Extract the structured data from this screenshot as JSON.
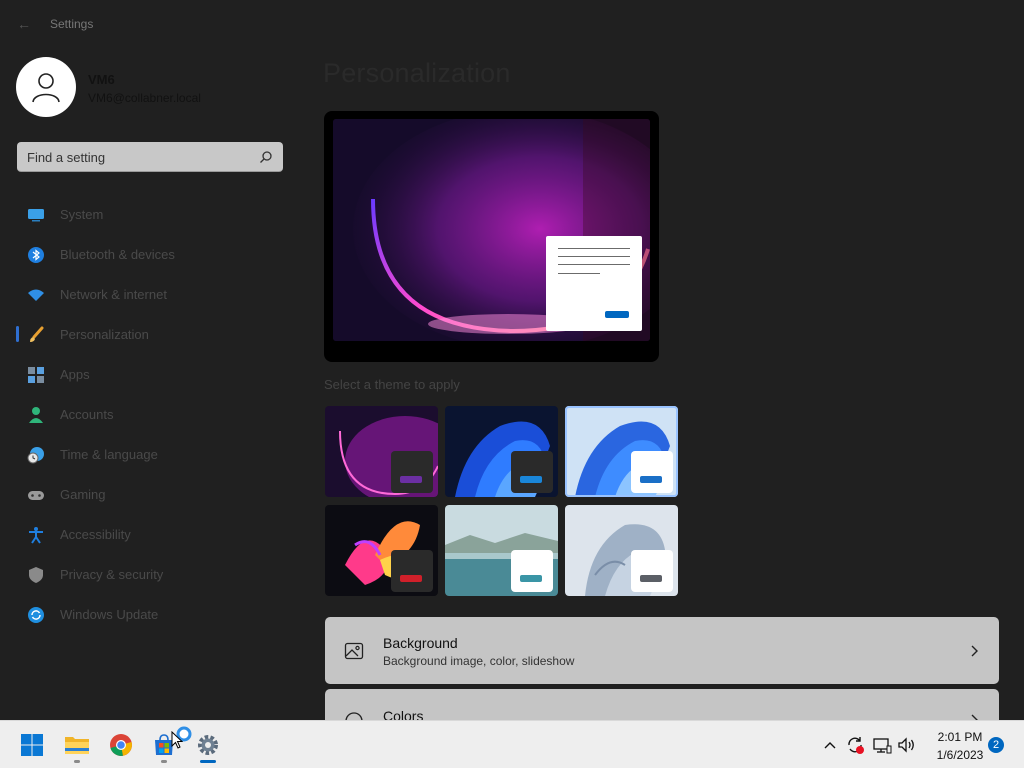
{
  "window": {
    "title": "Settings",
    "back_glyph": "←"
  },
  "profile": {
    "name": "VM6",
    "email": "VM6@collabner.local"
  },
  "search": {
    "placeholder": "Find a setting"
  },
  "sidebar": {
    "items": [
      {
        "label": "System",
        "icon": "monitor-icon"
      },
      {
        "label": "Bluetooth & devices",
        "icon": "bluetooth-icon"
      },
      {
        "label": "Network & internet",
        "icon": "wifi-icon"
      },
      {
        "label": "Personalization",
        "icon": "brush-icon",
        "active": true
      },
      {
        "label": "Apps",
        "icon": "apps-icon"
      },
      {
        "label": "Accounts",
        "icon": "person-icon"
      },
      {
        "label": "Time & language",
        "icon": "clock-globe-icon"
      },
      {
        "label": "Gaming",
        "icon": "gamepad-icon"
      },
      {
        "label": "Accessibility",
        "icon": "accessibility-icon"
      },
      {
        "label": "Privacy & security",
        "icon": "shield-icon"
      },
      {
        "label": "Windows Update",
        "icon": "sync-icon"
      }
    ]
  },
  "main": {
    "title": "Personalization",
    "themes_label": "Select a theme to apply",
    "themes": [
      {
        "name": "glow-dark",
        "accent": "#6b2fa3"
      },
      {
        "name": "bloom-dark",
        "accent": "#1a86d9"
      },
      {
        "name": "bloom-light",
        "accent": "#1a6fc7",
        "selected": true
      },
      {
        "name": "captured-motion",
        "accent": "#d0202a"
      },
      {
        "name": "sunrise-lake",
        "accent": "#3a95a6"
      },
      {
        "name": "flow",
        "accent": "#5b5f66"
      }
    ],
    "cards": [
      {
        "title": "Background",
        "subtitle": "Background image, color, slideshow",
        "icon": "image-icon"
      },
      {
        "title": "Colors",
        "subtitle": "",
        "icon": "palette-icon"
      }
    ]
  },
  "taskbar": {
    "apps": [
      {
        "name": "start-button",
        "icon": "windows-logo-icon"
      },
      {
        "name": "file-explorer",
        "icon": "folder-icon",
        "running": true
      },
      {
        "name": "chrome",
        "icon": "chrome-icon"
      },
      {
        "name": "microsoft-store",
        "icon": "store-icon",
        "running": true
      },
      {
        "name": "settings",
        "icon": "gear-icon",
        "running": true,
        "active": true
      }
    ],
    "tray": {
      "overflow_glyph": "^",
      "time": "2:01 PM",
      "date": "1/6/2023",
      "notifications": "2"
    }
  },
  "colors": {
    "accent": "#0067c0",
    "nav_indicator": "#2f6fd1",
    "card_bg": "#c5c5c5",
    "window_bg": "#202020"
  }
}
